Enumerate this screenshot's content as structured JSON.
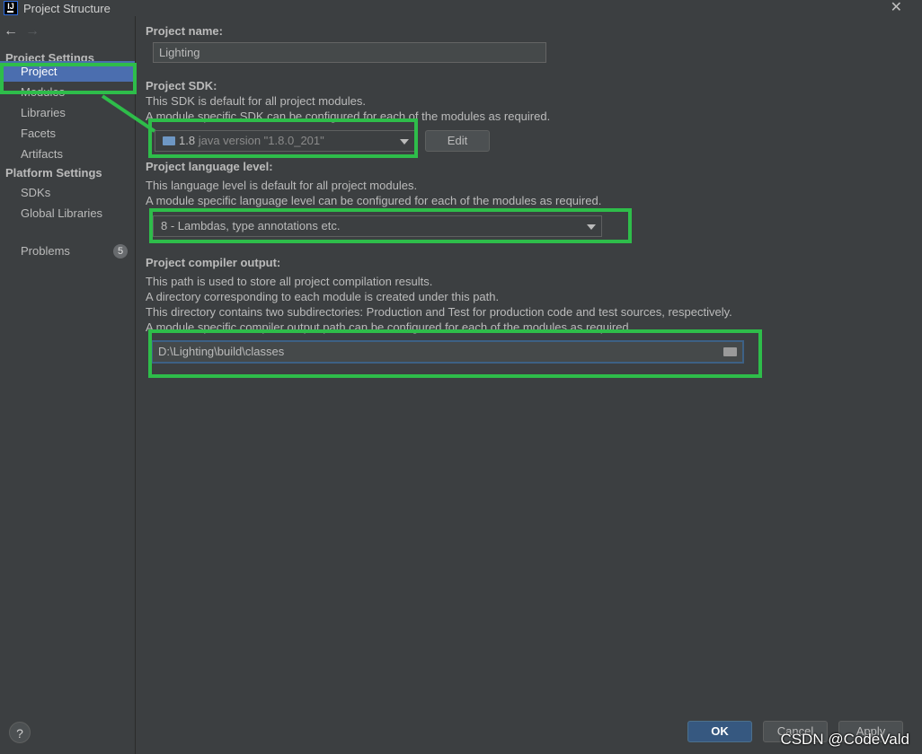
{
  "window": {
    "title": "Project Structure",
    "app_icon_text": "IJ"
  },
  "sidebar": {
    "back_icon": "arrow-left-icon",
    "forward_icon": "arrow-right-icon",
    "project_settings_title": "Project Settings",
    "project_settings_items": [
      {
        "label": "Project",
        "selected": true
      },
      {
        "label": "Modules"
      },
      {
        "label": "Libraries"
      },
      {
        "label": "Facets"
      },
      {
        "label": "Artifacts"
      }
    ],
    "platform_settings_title": "Platform Settings",
    "platform_settings_items": [
      {
        "label": "SDKs"
      },
      {
        "label": "Global Libraries"
      }
    ],
    "problems": {
      "label": "Problems",
      "count": "5"
    },
    "help_label": "?"
  },
  "main": {
    "project_name": {
      "label": "Project name:",
      "value": "Lighting"
    },
    "project_sdk": {
      "label": "Project SDK:",
      "desc1": "This SDK is default for all project modules.",
      "desc2": "A module specific SDK can be configured for each of the modules as required.",
      "sdk_version": "1.8",
      "sdk_detail": "java version \"1.8.0_201\"",
      "edit_label": "Edit"
    },
    "language_level": {
      "label": "Project language level:",
      "desc1": "This language level is default for all project modules.",
      "desc2": "A module specific language level can be configured for each of the modules as required.",
      "value": "8 - Lambdas, type annotations etc."
    },
    "compiler_output": {
      "label": "Project compiler output:",
      "desc1": "This path is used to store all project compilation results.",
      "desc2": "A directory corresponding to each module is created under this path.",
      "desc3": "This directory contains two subdirectories: Production and Test for production code and test sources, respectively.",
      "desc4": "A module specific compiler output path can be configured for each of the modules as required.",
      "value": "D:\\Lighting\\build\\classes"
    }
  },
  "footer": {
    "ok_label": "OK",
    "cancel_label": "Cancel",
    "apply_label": "Apply"
  },
  "watermark": "CSDN @CodeVald",
  "colors": {
    "highlight": "#2ebd4a",
    "selection": "#4b6eaf",
    "ok_button": "#365880"
  }
}
